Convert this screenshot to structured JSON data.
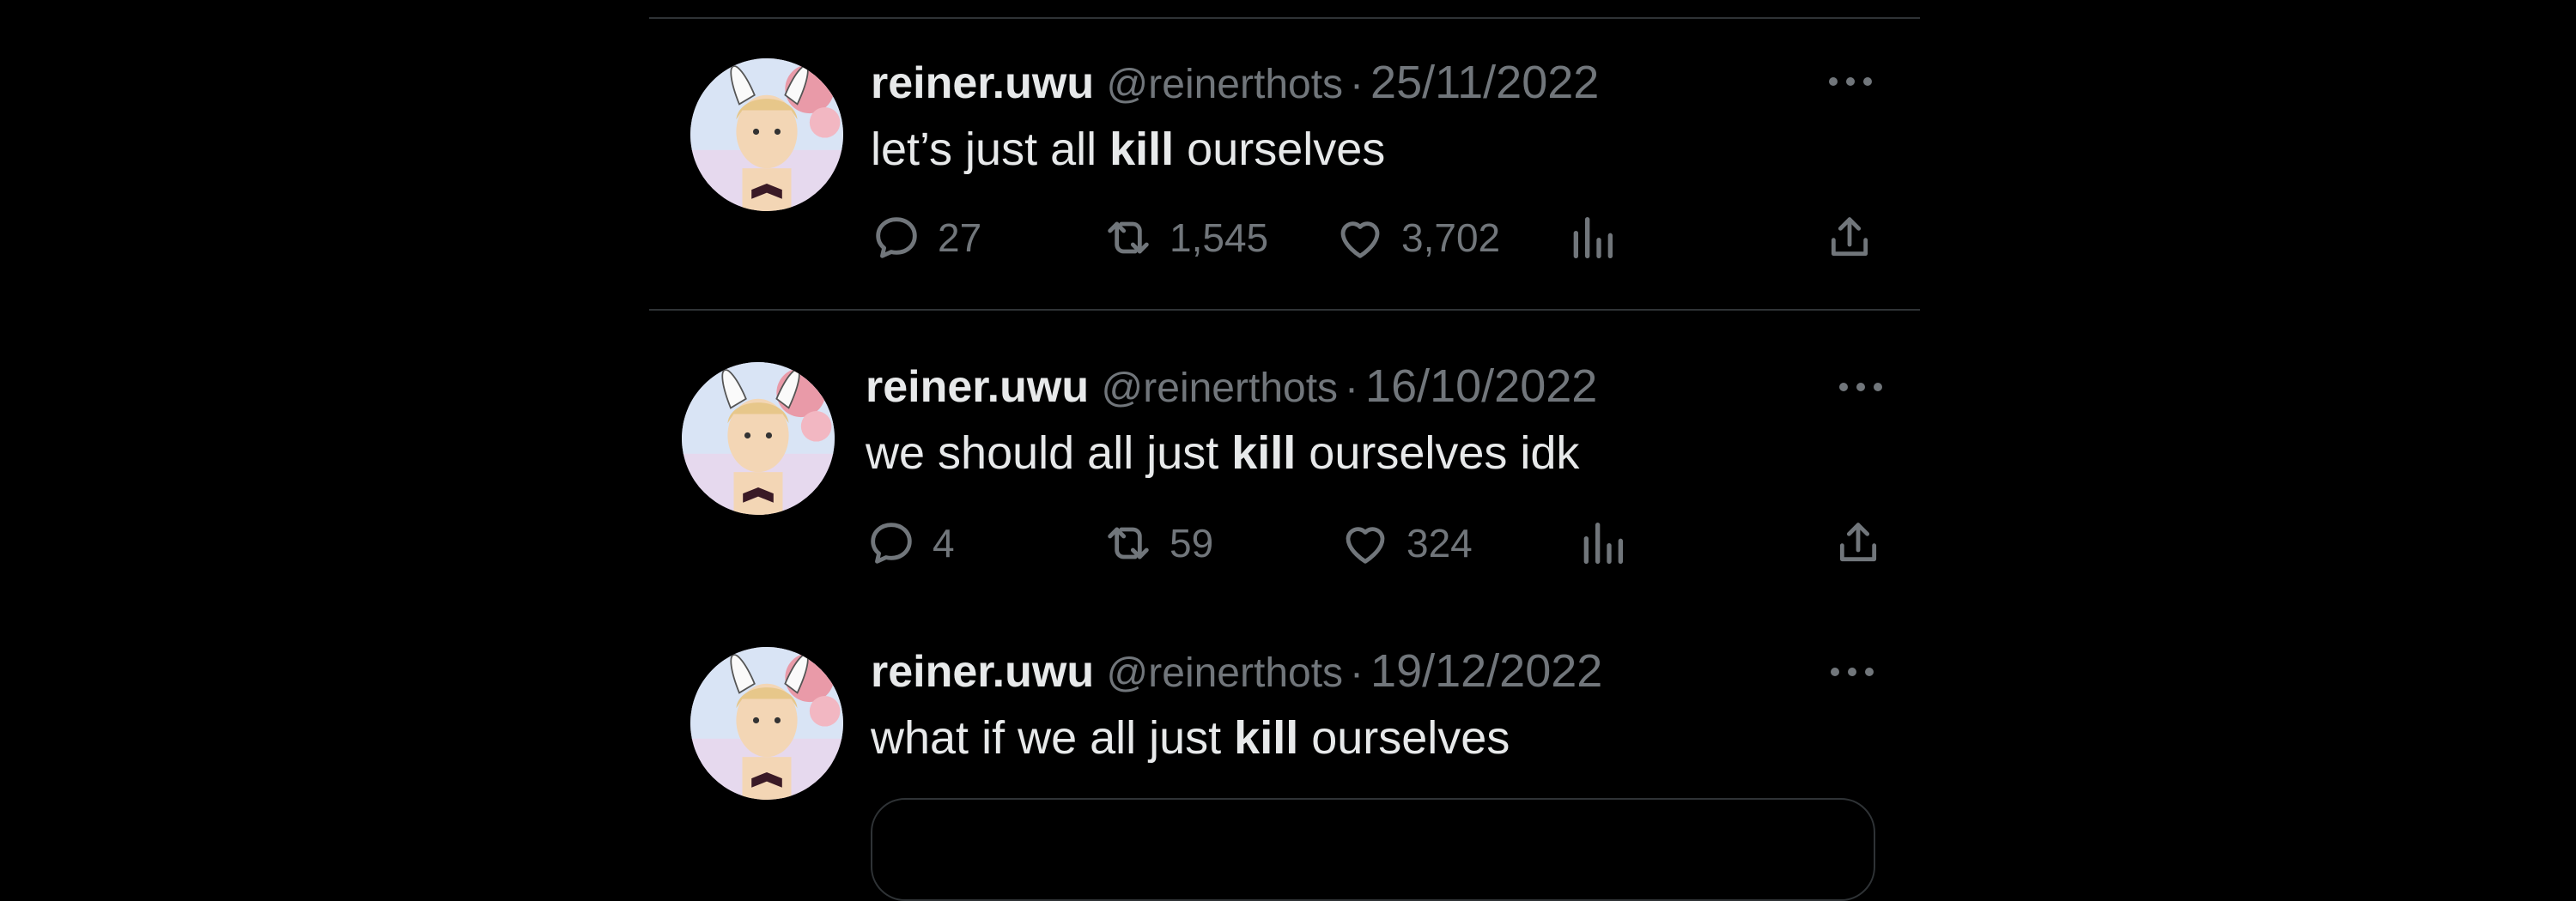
{
  "tweets": [
    {
      "display_name": "reiner.uwu",
      "handle": "@reinerthots",
      "separator": "·",
      "date": "25/11/2022",
      "text_before": "let’s just all ",
      "text_bold": "kill",
      "text_after": " ourselves",
      "replies": "27",
      "retweets": "1,545",
      "likes": "3,702"
    },
    {
      "display_name": "reiner.uwu",
      "handle": "@reinerthots",
      "separator": "·",
      "date": "16/10/2022",
      "text_before": "we should all just ",
      "text_bold": "kill",
      "text_after": " ourselves idk",
      "replies": "4",
      "retweets": "59",
      "likes": "324"
    },
    {
      "display_name": "reiner.uwu",
      "handle": "@reinerthots",
      "separator": "·",
      "date": "19/12/2022",
      "text_before": "what if we all just ",
      "text_bold": "kill",
      "text_after": " ourselves"
    }
  ],
  "icons": {
    "reply": "reply-icon",
    "retweet": "retweet-icon",
    "like": "heart-icon",
    "views": "views-chart-icon",
    "share": "share-icon",
    "more": "more-dots-icon"
  },
  "colors": {
    "background": "#000000",
    "primary_text": "#e7e9ea",
    "secondary_text": "#71767b",
    "divider": "#2f3336"
  }
}
